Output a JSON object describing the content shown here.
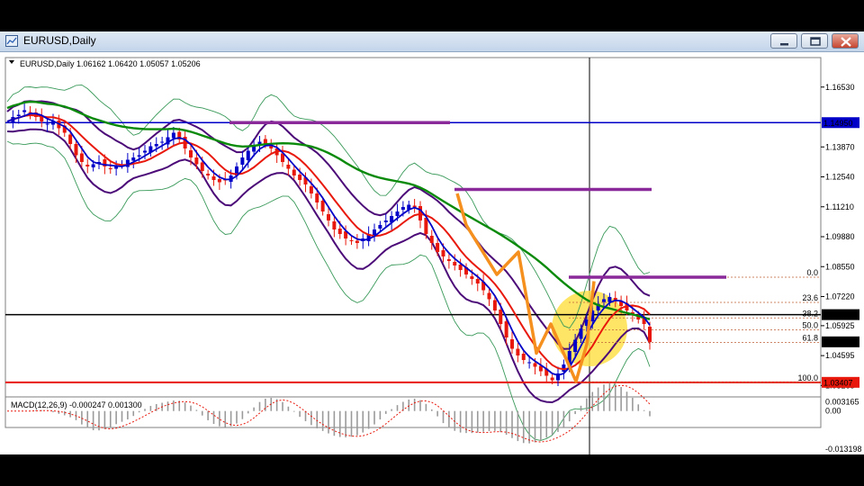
{
  "window": {
    "title": "EURUSD,Daily",
    "buttons": [
      "minimize-button",
      "restore-button",
      "close-button"
    ]
  },
  "chart_data": {
    "type": "candlestick",
    "symbol": "EURUSD",
    "timeframe": "Daily",
    "ohlc_label": "EURUSD,Daily  1.06162 1.06420 1.05057 1.05206",
    "y_ticks": [
      "1.16530",
      "1.13870",
      "1.12540",
      "1.11210",
      "1.09880",
      "1.08550",
      "1.07220",
      "1.05925",
      "1.04595",
      "1.03265"
    ],
    "ylim": [
      1.028,
      1.178
    ],
    "price_labels": [
      {
        "text": "1.14950",
        "value": 1.1495,
        "color": "#0000c8"
      },
      {
        "text": "1.06416",
        "value": 1.06416,
        "color": "#000000"
      },
      {
        "text": "1.05206",
        "value": 1.05206,
        "color": "#000000"
      },
      {
        "text": "1.03407",
        "value": 1.03407,
        "color": "#e8190c"
      }
    ],
    "horizontal_lines": [
      {
        "name": "blue-resistance",
        "value": 1.1495,
        "color": "#0000c8"
      },
      {
        "name": "black-current",
        "value": 1.06416,
        "color": "#000000"
      },
      {
        "name": "red-support",
        "value": 1.03407,
        "color": "#e8190c"
      }
    ],
    "fibonacci": {
      "levels": [
        {
          "label": "0.0",
          "value": 1.0808
        },
        {
          "label": "23.6",
          "value": 1.0696
        },
        {
          "label": "38.2",
          "value": 1.0627
        },
        {
          "label": "50.0",
          "value": 1.0574
        },
        {
          "label": "61.8",
          "value": 1.0518
        },
        {
          "label": "100.0",
          "value": 1.0341
        }
      ],
      "color": "#c0603a"
    },
    "close_series": [
      1.15,
      1.152,
      1.153,
      1.155,
      1.154,
      1.152,
      1.15,
      1.149,
      1.15,
      1.147,
      1.145,
      1.14,
      1.135,
      1.132,
      1.13,
      1.131,
      1.132,
      1.13,
      1.129,
      1.13,
      1.131,
      1.133,
      1.134,
      1.135,
      1.137,
      1.139,
      1.14,
      1.141,
      1.143,
      1.145,
      1.142,
      1.138,
      1.134,
      1.131,
      1.128,
      1.126,
      1.124,
      1.123,
      1.124,
      1.126,
      1.13,
      1.134,
      1.137,
      1.139,
      1.141,
      1.14,
      1.138,
      1.135,
      1.132,
      1.129,
      1.126,
      1.124,
      1.122,
      1.118,
      1.114,
      1.11,
      1.106,
      1.102,
      1.1,
      1.098,
      1.097,
      1.096,
      1.098,
      1.1,
      1.102,
      1.104,
      1.106,
      1.108,
      1.11,
      1.112,
      1.113,
      1.112,
      1.106,
      1.1,
      1.096,
      1.092,
      1.09,
      1.088,
      1.086,
      1.084,
      1.082,
      1.08,
      1.078,
      1.075,
      1.071,
      1.066,
      1.06,
      1.054,
      1.049,
      1.046,
      1.044,
      1.043,
      1.041,
      1.039,
      1.037,
      1.035,
      1.038,
      1.042,
      1.048,
      1.053,
      1.058,
      1.062,
      1.066,
      1.069,
      1.071,
      1.072,
      1.07,
      1.068,
      1.066,
      1.064,
      1.062,
      1.06,
      1.052
    ],
    "moving_averages": [
      {
        "name": "green-ma",
        "color": "#0a8a0a"
      },
      {
        "name": "red-ma",
        "color": "#e8190c"
      },
      {
        "name": "blue-ma",
        "color": "#0000c8"
      },
      {
        "name": "purple-band",
        "color": "#4b0a78"
      },
      {
        "name": "outer-band",
        "color": "#3a9a5a"
      }
    ],
    "annotations": [
      {
        "name": "purple-level-1",
        "value": 1.1495,
        "color": "#8a2a9a"
      },
      {
        "name": "purple-level-2",
        "value": 1.1198,
        "color": "#8a2a9a"
      },
      {
        "name": "purple-level-3",
        "value": 1.0808,
        "color": "#8a2a9a"
      },
      {
        "name": "orange-zigzag",
        "color": "#f5901e"
      },
      {
        "name": "yellow-highlight",
        "color": "#ffe14a"
      }
    ],
    "macd": {
      "label": "MACD(12,26,9) -0.000247 0.001300",
      "y_ticks": [
        "0.003165",
        "0.00",
        "-0.013198"
      ],
      "ylim": [
        -0.0142,
        0.0042
      ]
    }
  }
}
